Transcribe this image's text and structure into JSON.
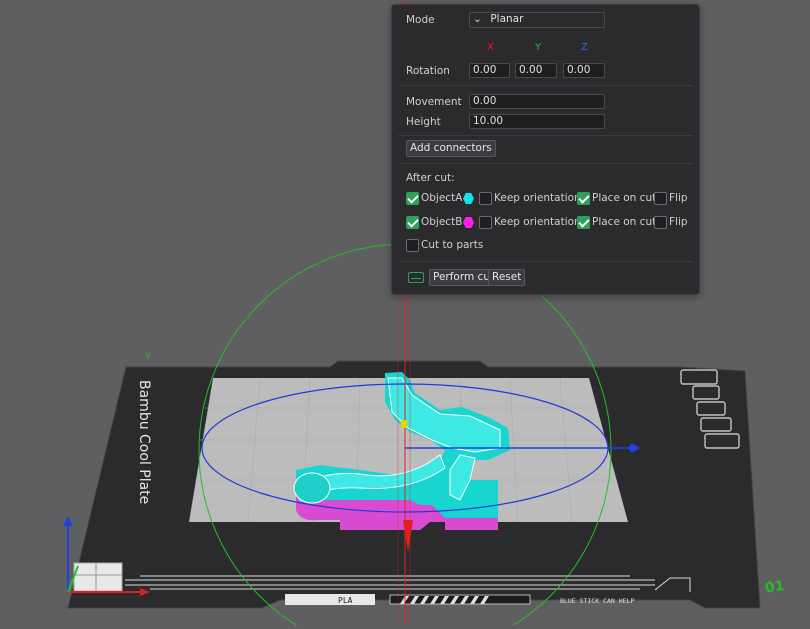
{
  "cut_panel": {
    "mode_label": "Mode",
    "mode_value": "Planar",
    "axis_headers": [
      "X",
      "Y",
      "Z"
    ],
    "rotation_label": "Rotation",
    "rotation": [
      "0.00",
      "0.00",
      "0.00"
    ],
    "movement_label": "Movement",
    "movement_value": "0.00",
    "height_label": "Height",
    "height_value": "10.00",
    "add_connectors_label": "Add connectors",
    "after_cut_label": "After cut:",
    "object_a": {
      "label": "ObjectA",
      "color": "#11e3e3",
      "checked": true,
      "keep_orientation_label": "Keep orientation",
      "keep_orientation_checked": false,
      "place_on_cut_label": "Place on cut",
      "place_on_cut_checked": true,
      "flip_label": "Flip",
      "flip_checked": false
    },
    "object_b": {
      "label": "ObjectB",
      "color": "#ff1ee8",
      "checked": true,
      "keep_orientation_label": "Keep orientation",
      "keep_orientation_checked": false,
      "place_on_cut_label": "Place on cut",
      "place_on_cut_checked": true,
      "flip_label": "Flip",
      "flip_checked": false
    },
    "cut_to_parts_label": "Cut to parts",
    "cut_to_parts_checked": false,
    "perform_cut_label": "Perform cut",
    "reset_label": "Reset",
    "keyboard_icon": "keyboard-icon"
  },
  "scene": {
    "plate_text": "Bambu Cool Plate",
    "plate_tag": "PLA",
    "plate_hint": "BLUE STICK CAN HELP",
    "plate_number": "01",
    "colors": {
      "background": "#5f5f61",
      "bed": "#2b2b2e",
      "print_area": "#bcbcbc",
      "part_a": "#11e3e3",
      "part_b": "#e04ad6",
      "axis_x": "#e02020",
      "axis_y": "#22c022",
      "axis_z": "#2040e0",
      "accent": "#2ea05a"
    }
  }
}
